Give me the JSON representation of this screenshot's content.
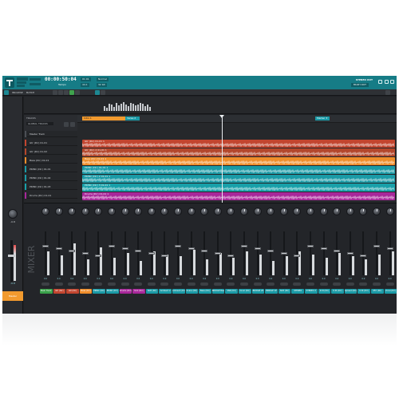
{
  "topbar": {
    "time": "00:00:50:04",
    "tempo_label": "Tempo",
    "right_title": "STEREO OUT",
    "right_button": "MULTI OUT",
    "fields": [
      "01:01",
      "Normal",
      "44.1",
      "32 bit"
    ]
  },
  "toolbar": {
    "project_label": "BROWSE",
    "mode_label": "MATCH",
    "icons": [
      "select-tool-icon",
      "cut-tool-icon",
      "draw-tool-icon",
      "play-icon",
      "record-icon",
      "loop-icon",
      "metronome-icon"
    ]
  },
  "tracks_header": {
    "title": "TRACKS",
    "filter": "GLOBAL TRACKS"
  },
  "markers": {
    "intro": "Intro 1",
    "verse": "Verse 2",
    "marker3": "Marker 3"
  },
  "tracks": [
    {
      "name": "Master Track",
      "clip": "",
      "color": "#4b4f55"
    },
    {
      "name": "Gtr (Dir) 01-01",
      "clip": "Gtr (Dir) 01-01 1",
      "color": "#c2452f"
    },
    {
      "name": "Gtr (Dir) 01-02",
      "clip": "Gtr (Dir) 2 01-01 1",
      "color": "#b4472c"
    },
    {
      "name": "Bass (Dir) 01-01",
      "clip": "Bass (Dir) 01-01 1",
      "color": "#ef8d2a"
    },
    {
      "name": "PRINC (Dir) 01-01",
      "clip": "PRINC (Dir) 01-01 1",
      "color": "#1a9aa6"
    },
    {
      "name": "PRINC (Dir) 01-02",
      "clip": "PRINC (Dir) 2 01-01 1",
      "color": "#1a9aa6"
    },
    {
      "name": "PRINC (Dir) 01-03",
      "clip": "PRINC (Dir) 3 01-01 1",
      "color": "#18a0a9"
    },
    {
      "name": "Drums (Dir) 01-01",
      "clip": "Drums (Dir) 01-01 1",
      "color": "#a8279a"
    }
  ],
  "mixer": {
    "label": "MIXER",
    "master_value": "-0.8",
    "master_db": "-0.8",
    "master_name": "Master",
    "channels": [
      {
        "name": "Main Track",
        "color": "#3aa14a",
        "value": "0.0"
      },
      {
        "name": "Gtr (Dir)",
        "color": "#c2452f",
        "value": "0.0"
      },
      {
        "name": "Gtr (Dir)",
        "color": "#c2452f",
        "value": "0.0"
      },
      {
        "name": "Bass (Dir)",
        "color": "#ef8d2a",
        "value": "0.0"
      },
      {
        "name": "PRINC (Dir)",
        "color": "#1a9aa6",
        "value": "0.0"
      },
      {
        "name": "PRINC (Dir)",
        "color": "#1a9aa6",
        "value": "0.0"
      },
      {
        "name": "Drums (Dir)",
        "color": "#a8279a",
        "value": "0.0"
      },
      {
        "name": "Kick (Dir)",
        "color": "#a8279a",
        "value": "0.0"
      },
      {
        "name": "SUB (Dir)",
        "color": "#1a9aa6",
        "value": "0.0"
      },
      {
        "name": "Ambient 2",
        "color": "#1a9aa6",
        "value": "0.0"
      },
      {
        "name": "Ambient (Dir)",
        "color": "#1a9aa6",
        "value": "0.0"
      },
      {
        "name": "Snare (Dir)",
        "color": "#1a9aa6",
        "value": "0.0"
      },
      {
        "name": "Bass (Dir)",
        "color": "#1a9aa6",
        "value": "0.0"
      },
      {
        "name": "BRIDGE Bass",
        "color": "#1a9aa6",
        "value": "0.0"
      },
      {
        "name": "SNR (Dir)",
        "color": "#1a9aa6",
        "value": "0.0"
      },
      {
        "name": "Vocal (Dir)",
        "color": "#1a9aa6",
        "value": "0.0"
      },
      {
        "name": "BRIDGE 2P",
        "color": "#1a9aa6",
        "value": "0.0"
      },
      {
        "name": "BRIDGE 1P",
        "color": "#1a9aa6",
        "value": "0.0"
      },
      {
        "name": "SUB (Dir)",
        "color": "#1a9aa6",
        "value": "0.0"
      },
      {
        "name": "STEREO",
        "color": "#1a9aa6",
        "value": "0.0"
      },
      {
        "name": "STEREO 2",
        "color": "#1a9aa6",
        "value": "0.0"
      },
      {
        "name": "K.St (Dir)",
        "color": "#1a9aa6",
        "value": "0.0"
      },
      {
        "name": "K.St (Dir)",
        "color": "#1a9aa6",
        "value": "0.0"
      },
      {
        "name": "Spread (Dir)",
        "color": "#1a9aa6",
        "value": "0.0"
      },
      {
        "name": "K.St (Dir)",
        "color": "#1a9aa6",
        "value": "0.0"
      },
      {
        "name": "SFX (Dir)",
        "color": "#1a9aa6",
        "value": "0.0"
      },
      {
        "name": "Vocal (Dir)",
        "color": "#1a9aa6",
        "value": "0.0"
      }
    ]
  }
}
